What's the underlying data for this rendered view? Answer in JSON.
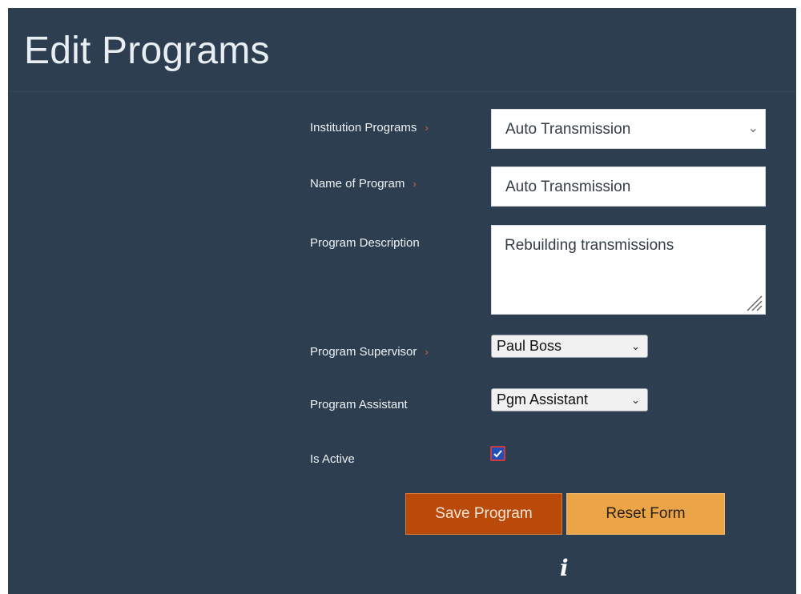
{
  "page": {
    "title": "Edit Programs"
  },
  "form": {
    "institution_programs": {
      "label": "Institution Programs",
      "value": "Auto Transmission",
      "required": true
    },
    "name_of_program": {
      "label": "Name of Program",
      "value": "Auto Transmission",
      "required": true
    },
    "program_description": {
      "label": "Program Description",
      "value": "Rebuilding transmissions"
    },
    "program_supervisor": {
      "label": "Program Supervisor",
      "value": "Paul Boss",
      "required": true
    },
    "program_assistant": {
      "label": "Program Assistant",
      "value": "Pgm Assistant"
    },
    "is_active": {
      "label": "Is Active",
      "checked": true
    }
  },
  "icons": {
    "required": "chevron-right-icon",
    "select_arrow": "chevron-down-icon",
    "info": "info-icon",
    "resize": "resize-handle-icon",
    "check": "check-icon"
  },
  "buttons": {
    "save_label": "Save Program",
    "reset_label": "Reset Form"
  },
  "colors": {
    "background": "#2c3e50",
    "save_button": "#b94a0a",
    "reset_button": "#eba446",
    "required_marker": "#e05a47",
    "checkbox_fill": "#1f4fb8"
  }
}
